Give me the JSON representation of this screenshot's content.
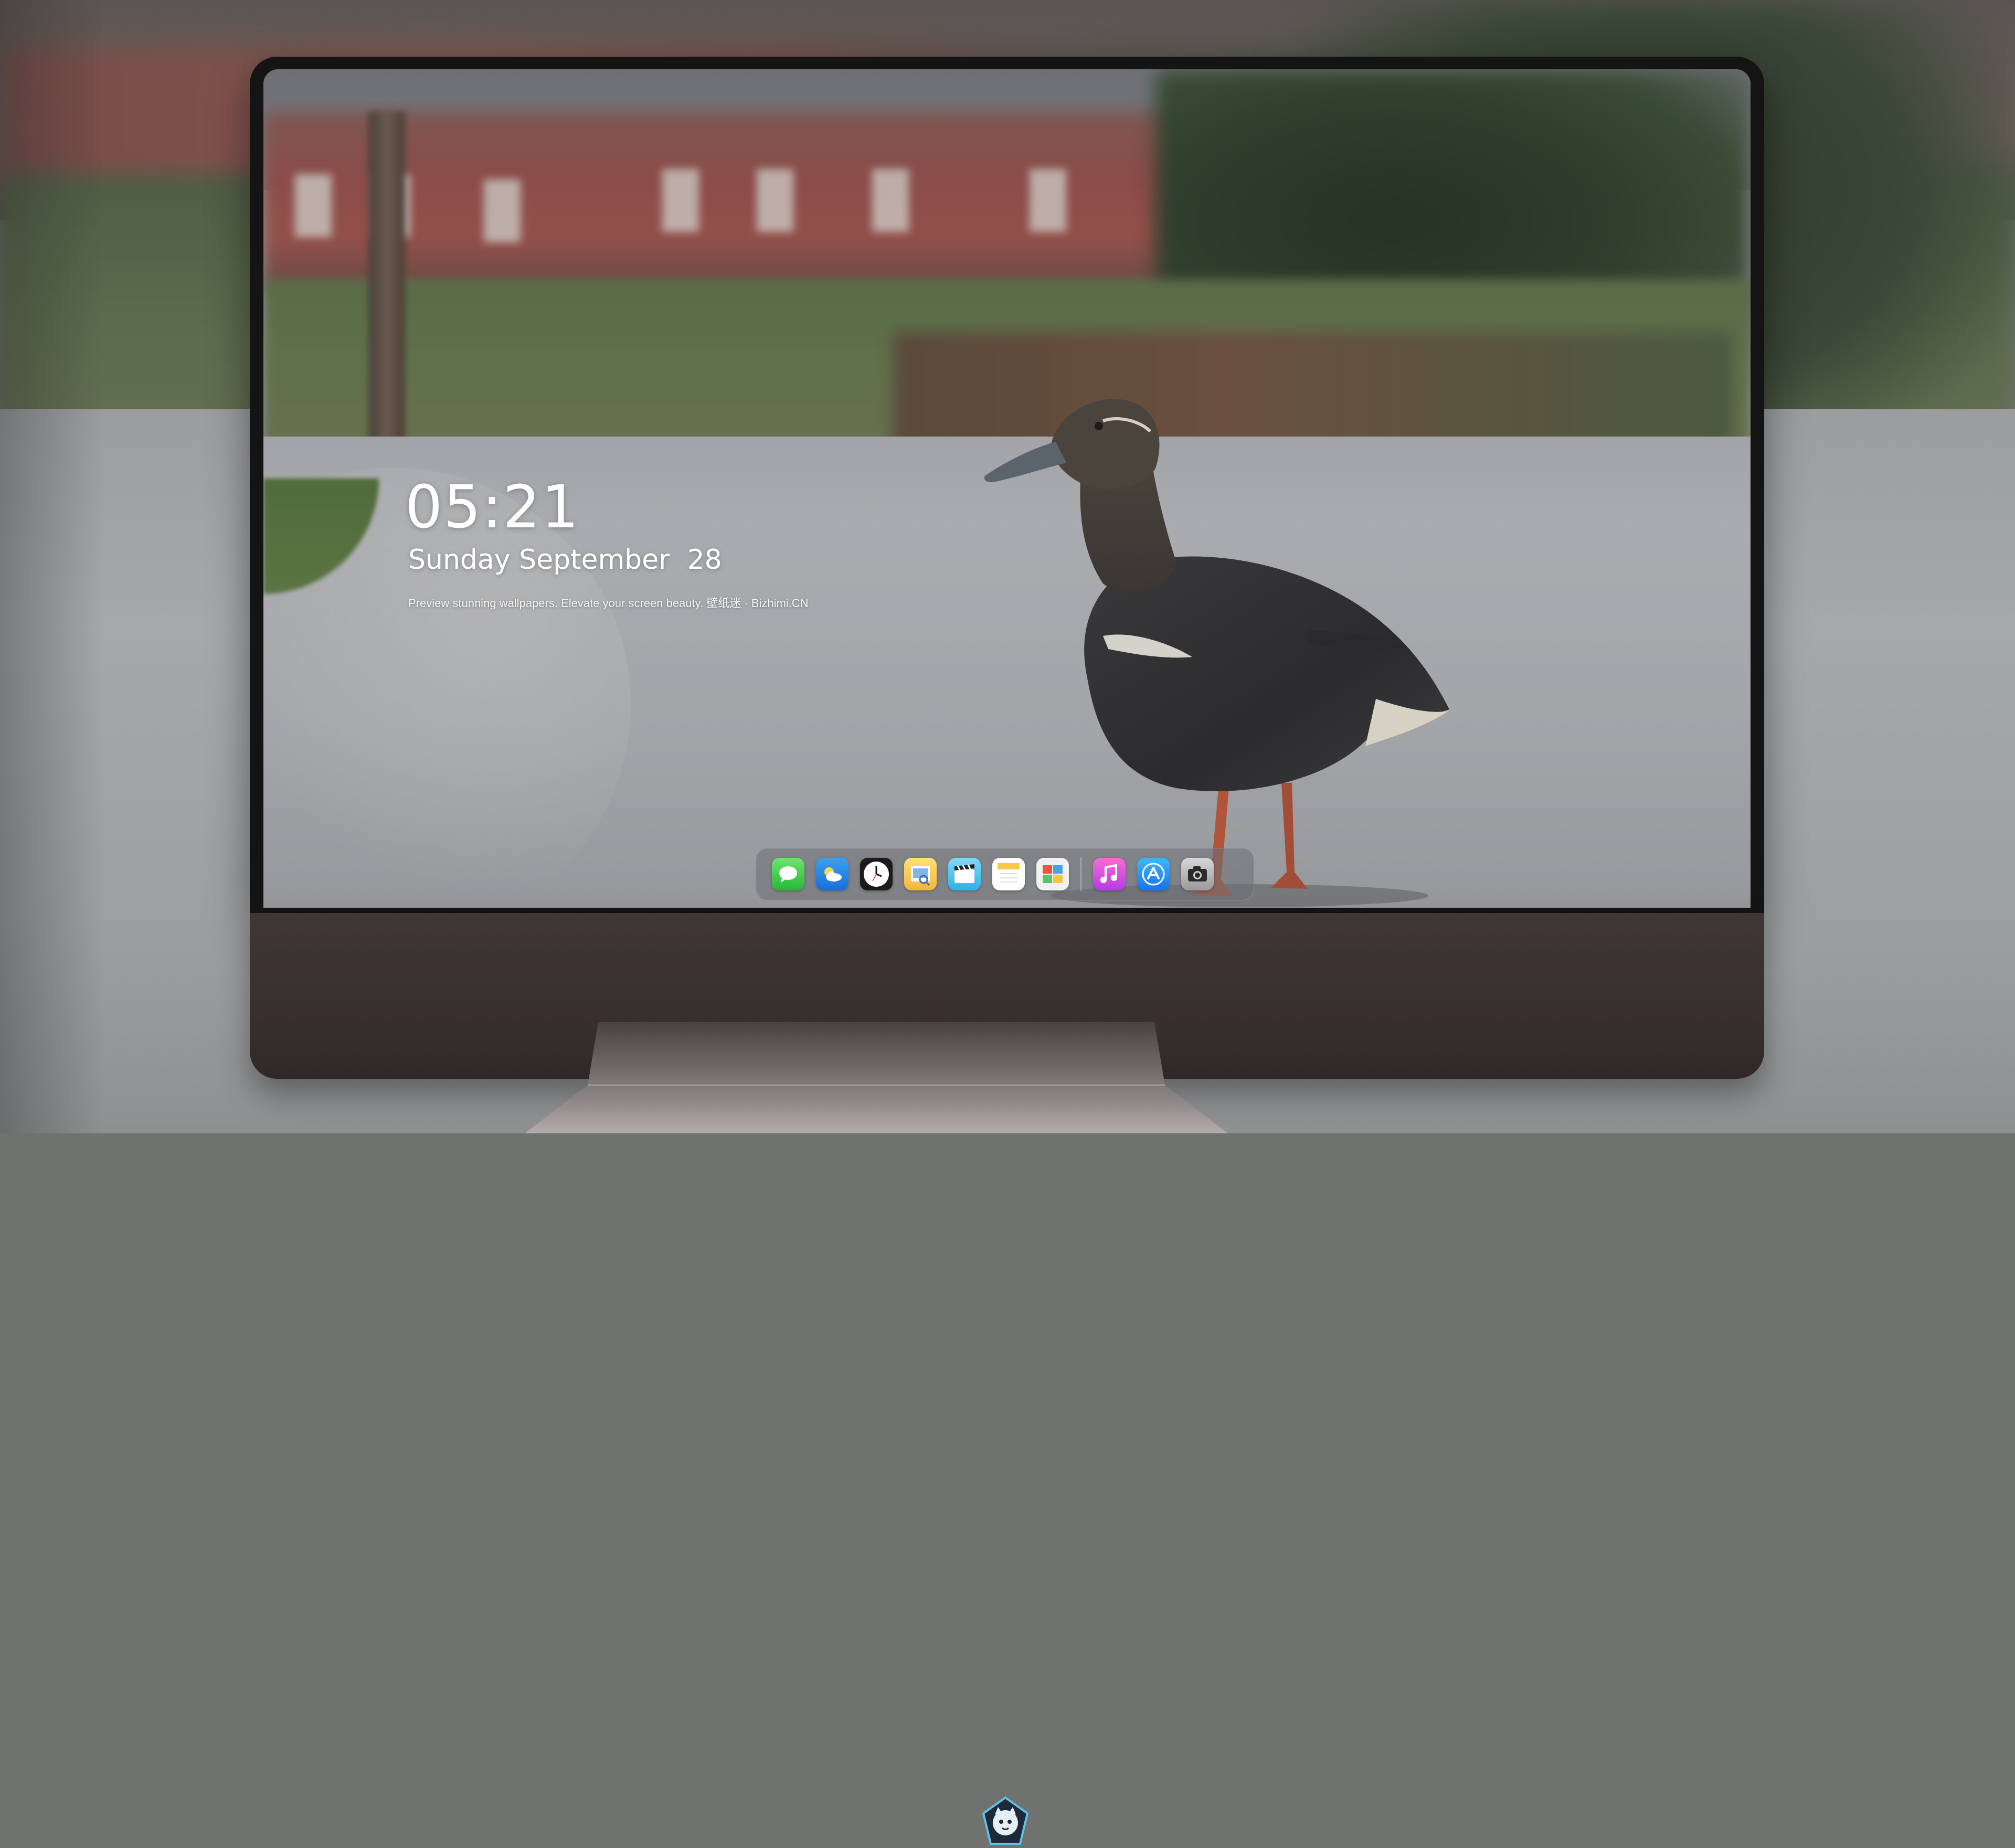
{
  "lockscreen": {
    "time": "05:21",
    "date": "Sunday September  28",
    "tagline": "Preview stunning wallpapers. Elevate your screen beauty. 壁纸迷 · Bizhimi.CN"
  },
  "dock": {
    "apps": [
      {
        "icon": "messages-icon"
      },
      {
        "icon": "weather-icon"
      },
      {
        "icon": "clock-icon"
      },
      {
        "icon": "preview-icon"
      },
      {
        "icon": "clips-icon"
      },
      {
        "icon": "notes-icon"
      },
      {
        "icon": "photo-booth-icon"
      },
      {
        "icon": "music-icon"
      },
      {
        "icon": "app-store-icon"
      },
      {
        "icon": "camera-icon"
      }
    ]
  },
  "colors": {
    "monitor_bezel": "#141414",
    "monitor_chin": "#3a3132",
    "text": "#ffffff"
  }
}
